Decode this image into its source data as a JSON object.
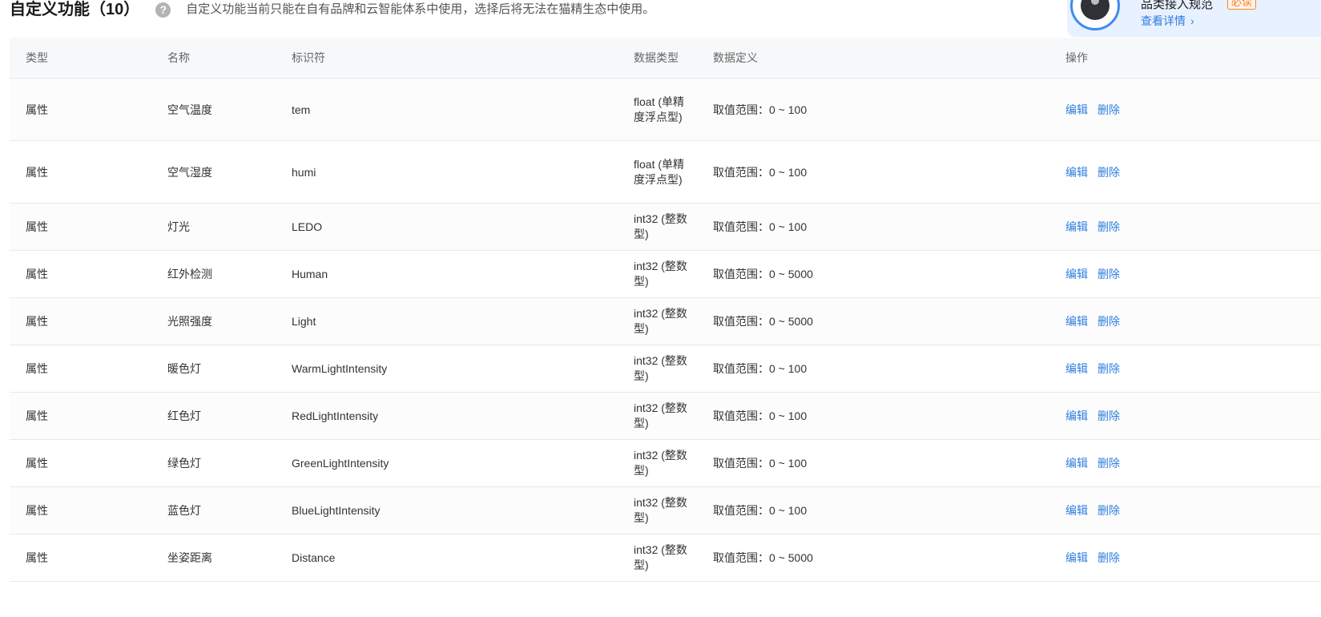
{
  "header": {
    "title": "自定义功能（10）",
    "help_icon": "?",
    "description": "自定义功能当前只能在自有品牌和云智能体系中使用，选择后将无法在猫精生态中使用。"
  },
  "promo": {
    "title": "品类接入规范",
    "badge": "必读",
    "link_label": "查看详情",
    "link_chevron": "›"
  },
  "table": {
    "columns": [
      "类型",
      "名称",
      "标识符",
      "数据类型",
      "数据定义",
      "操作"
    ],
    "rows": [
      {
        "type": "属性",
        "name": "空气温度",
        "identifier": "tem",
        "data_type": "float (单精度浮点型)",
        "definition": "取值范围：0 ~ 100",
        "edit": "编辑",
        "delete": "删除"
      },
      {
        "type": "属性",
        "name": "空气湿度",
        "identifier": "humi",
        "data_type": "float (单精度浮点型)",
        "definition": "取值范围：0 ~ 100",
        "edit": "编辑",
        "delete": "删除"
      },
      {
        "type": "属性",
        "name": "灯光",
        "identifier": "LEDO",
        "data_type": "int32 (整数型)",
        "definition": "取值范围：0 ~ 100",
        "edit": "编辑",
        "delete": "删除"
      },
      {
        "type": "属性",
        "name": "红外检测",
        "identifier": "Human",
        "data_type": "int32 (整数型)",
        "definition": "取值范围：0 ~ 5000",
        "edit": "编辑",
        "delete": "删除"
      },
      {
        "type": "属性",
        "name": "光照强度",
        "identifier": "Light",
        "data_type": "int32 (整数型)",
        "definition": "取值范围：0 ~ 5000",
        "edit": "编辑",
        "delete": "删除"
      },
      {
        "type": "属性",
        "name": "暖色灯",
        "identifier": "WarmLightIntensity",
        "data_type": "int32 (整数型)",
        "definition": "取值范围：0 ~ 100",
        "edit": "编辑",
        "delete": "删除"
      },
      {
        "type": "属性",
        "name": "红色灯",
        "identifier": "RedLightIntensity",
        "data_type": "int32 (整数型)",
        "definition": "取值范围：0 ~ 100",
        "edit": "编辑",
        "delete": "删除"
      },
      {
        "type": "属性",
        "name": "绿色灯",
        "identifier": "GreenLightIntensity",
        "data_type": "int32 (整数型)",
        "definition": "取值范围：0 ~ 100",
        "edit": "编辑",
        "delete": "删除"
      },
      {
        "type": "属性",
        "name": "蓝色灯",
        "identifier": "BlueLightIntensity",
        "data_type": "int32 (整数型)",
        "definition": "取值范围：0 ~ 100",
        "edit": "编辑",
        "delete": "删除"
      },
      {
        "type": "属性",
        "name": "坐姿距离",
        "identifier": "Distance",
        "data_type": "int32 (整数型)",
        "definition": "取值范围：0 ~ 5000",
        "edit": "编辑",
        "delete": "删除"
      }
    ]
  },
  "colors": {
    "link": "#2f7de1",
    "header_bg": "#f7f8fa",
    "border": "#e8e8e8",
    "promo_bg": "#e8f1ff",
    "badge": "#f5842a"
  },
  "icons": [
    "help-icon",
    "chevron-right-icon"
  ]
}
